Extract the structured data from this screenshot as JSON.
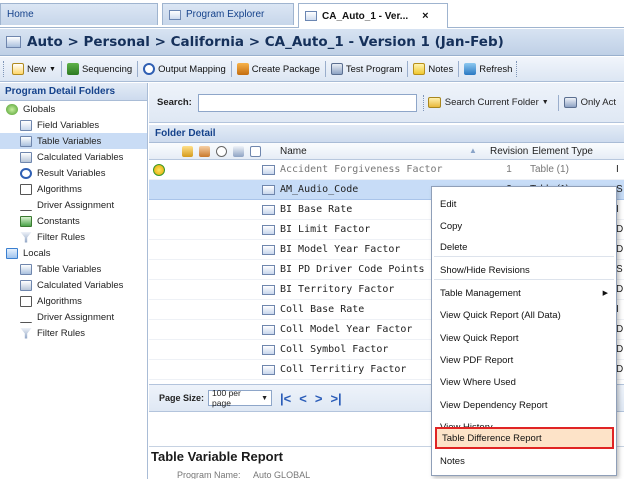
{
  "tabs": [
    {
      "label": "Home",
      "active": false
    },
    {
      "label": "Program Explorer",
      "active": false,
      "icon": "program-explorer-icon"
    },
    {
      "label": "CA_Auto_1 - Ver...",
      "active": true,
      "icon": "table-icon",
      "close": "×"
    }
  ],
  "title": {
    "text": "Auto > Personal > California > CA_Auto_1 - Version 1 (Jan-Feb)"
  },
  "toolbar": {
    "new_label": "New",
    "sequencing_label": "Sequencing",
    "output_mapping_label": "Output Mapping",
    "create_package_label": "Create Package",
    "test_program_label": "Test Program",
    "notes_label": "Notes",
    "refresh_label": "Refresh"
  },
  "left": {
    "header": "Program Detail Folders",
    "globals_label": "Globals",
    "globals": [
      {
        "label": "Field Variables",
        "icon": "field-variables-icon"
      },
      {
        "label": "Table Variables",
        "icon": "table-variables-icon",
        "selected": true
      },
      {
        "label": "Calculated Variables",
        "icon": "calculated-variables-icon"
      },
      {
        "label": "Result Variables",
        "icon": "result-variables-icon"
      },
      {
        "label": "Algorithms",
        "icon": "algorithms-icon"
      },
      {
        "label": "Driver Assignment",
        "icon": "driver-assignment-icon"
      },
      {
        "label": "Constants",
        "icon": "constants-icon"
      },
      {
        "label": "Filter Rules",
        "icon": "filter-rules-icon"
      }
    ],
    "locals_label": "Locals",
    "locals": [
      {
        "label": "Table Variables",
        "icon": "table-variables-icon"
      },
      {
        "label": "Calculated Variables",
        "icon": "calculated-variables-icon"
      },
      {
        "label": "Algorithms",
        "icon": "algorithms-icon"
      },
      {
        "label": "Driver Assignment",
        "icon": "driver-assignment-icon"
      },
      {
        "label": "Filter Rules",
        "icon": "filter-rules-icon"
      }
    ]
  },
  "search": {
    "label": "Search:",
    "value": "",
    "search_folder_label": "Search Current Folder",
    "only_active_label": "Only Act"
  },
  "folder_detail": {
    "header": "Folder Detail",
    "columns": {
      "name": "Name",
      "revision": "Revision",
      "element_type": "Element Type"
    },
    "rows": [
      {
        "name": "Accident Forgiveness Factor",
        "revision": "1",
        "element_type": "Table (1)",
        "trail": "I",
        "grey": true
      },
      {
        "name": "AM_Audio_Code",
        "revision": "2",
        "element_type": "Table (1)",
        "trail": "S",
        "selected": true
      },
      {
        "name": "BI Base Rate",
        "revision": "",
        "element_type": "",
        "trail": "I"
      },
      {
        "name": "BI Limit Factor",
        "revision": "",
        "element_type": "",
        "trail": "D"
      },
      {
        "name": "BI Model Year Factor",
        "revision": "",
        "element_type": "",
        "trail": "D"
      },
      {
        "name": "BI PD Driver Code Points",
        "revision": "",
        "element_type": "",
        "trail": "S"
      },
      {
        "name": "BI Territory Factor",
        "revision": "",
        "element_type": "",
        "trail": "D"
      },
      {
        "name": "Coll Base Rate",
        "revision": "",
        "element_type": "",
        "trail": "I"
      },
      {
        "name": "Coll Model Year Factor",
        "revision": "",
        "element_type": "",
        "trail": "D"
      },
      {
        "name": "Coll Symbol Factor",
        "revision": "",
        "element_type": "",
        "trail": "D"
      },
      {
        "name": "Coll Territiry Factor",
        "revision": "",
        "element_type": "",
        "trail": "D"
      }
    ]
  },
  "pager": {
    "label": "Page Size:",
    "value": "100 per page"
  },
  "report": {
    "title": "Table Variable Report",
    "program_label": "Program Name:",
    "program_value": "Auto GLOBAL"
  },
  "context_menu": [
    {
      "label": "Edit"
    },
    {
      "label": "Copy"
    },
    {
      "label": "Delete"
    },
    {
      "label": "Show/Hide Revisions"
    },
    {
      "label": "Table Management",
      "submenu": true
    },
    {
      "label": "View Quick Report (All Data)"
    },
    {
      "label": "View Quick Report"
    },
    {
      "label": "View PDF Report"
    },
    {
      "label": "View Where Used"
    },
    {
      "label": "View Dependency Report"
    },
    {
      "label": "View History"
    },
    {
      "label": "Table Difference Report",
      "highlighted": true
    },
    {
      "label": "Notes"
    }
  ],
  "colors": {
    "accent": "#15428b",
    "highlight_border": "#e02424",
    "selection": "#c7dcf7"
  }
}
